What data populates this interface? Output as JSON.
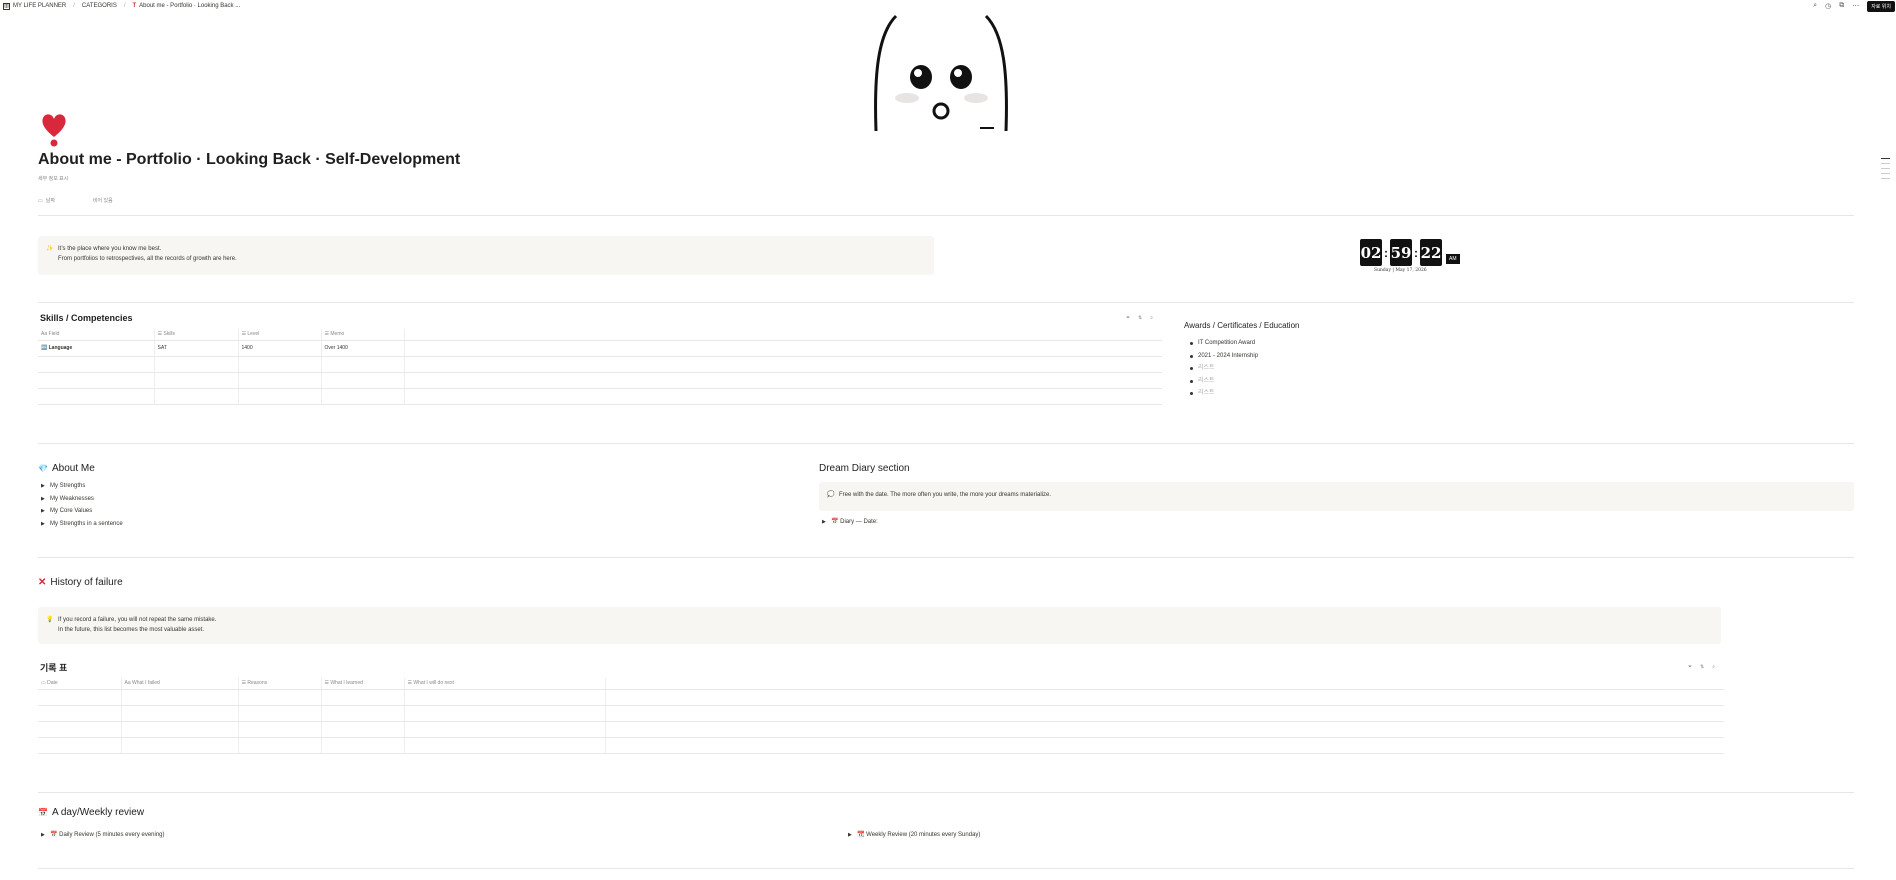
{
  "topbar": {
    "workspace": "MY LIFE PLANNER",
    "crumb2": "CATEGORIS",
    "current_page": "About me - Portfolio · Looking Back ...",
    "share_label": "자료 위치"
  },
  "page": {
    "title": "About me - Portfolio · Looking Back · Self-Development",
    "subtitle": "세부 정보 표시",
    "prop_date": "날짜",
    "prop_empty": "비어 있음"
  },
  "intro_callout": {
    "icon": "✨",
    "line1": "It’s the place where you know me best.",
    "line2": "From portfolios to retrospectives, all the records of growth are here."
  },
  "clock": {
    "h": "02",
    "m": "59",
    "s": "22",
    "ampm": "AM",
    "date": "Sunday | May 17, 2026"
  },
  "skills": {
    "title": "Skills / Competencies",
    "columns": [
      "Field",
      "Skills",
      "Level",
      "Memo"
    ],
    "rows": [
      [
        "Language",
        "SAT",
        "1400",
        "Over 1400"
      ],
      [
        "",
        "",
        "",
        ""
      ],
      [
        "",
        "",
        "",
        ""
      ],
      [
        "",
        "",
        "",
        ""
      ]
    ]
  },
  "awards": {
    "title": "Awards / Certificates / Education",
    "items": [
      "IT Competition Award",
      "2021 - 2024 Internship",
      "리스트",
      "리스트",
      "리스트"
    ]
  },
  "about_me": {
    "icon": "💎",
    "title": "About Me",
    "toggles": [
      "My Strengths",
      "My Weaknesses",
      "My Core Values",
      "My Strengths in a sentence"
    ]
  },
  "dream_diary": {
    "title": "Dream Diary section",
    "callout_icon": "💭",
    "callout_text": "Free with the date. The more often you write, the more your dreams materialize.",
    "toggle": "📅 Diary — Date:"
  },
  "failure": {
    "title": "History of failure",
    "callout_icon": "💡",
    "callout_line1": "If you record a failure, you will not repeat the same mistake.",
    "callout_line2": "In the future, this list becomes the most valuable asset."
  },
  "record_table": {
    "title": "기록 표",
    "columns": [
      "Date",
      "What I failed",
      "Reasons",
      "What I learned",
      "What I will do next"
    ],
    "rows": [
      [
        "",
        "",
        "",
        "",
        ""
      ],
      [
        "",
        "",
        "",
        "",
        ""
      ],
      [
        "",
        "",
        "",
        "",
        ""
      ],
      [
        "",
        "",
        "",
        "",
        ""
      ]
    ]
  },
  "review": {
    "icon": "📅",
    "title": "A day/Weekly review",
    "daily": "📅 Daily Review (5 minutes every evening)",
    "weekly": "📆 Weekly Review (20 minutes every Sunday)"
  }
}
